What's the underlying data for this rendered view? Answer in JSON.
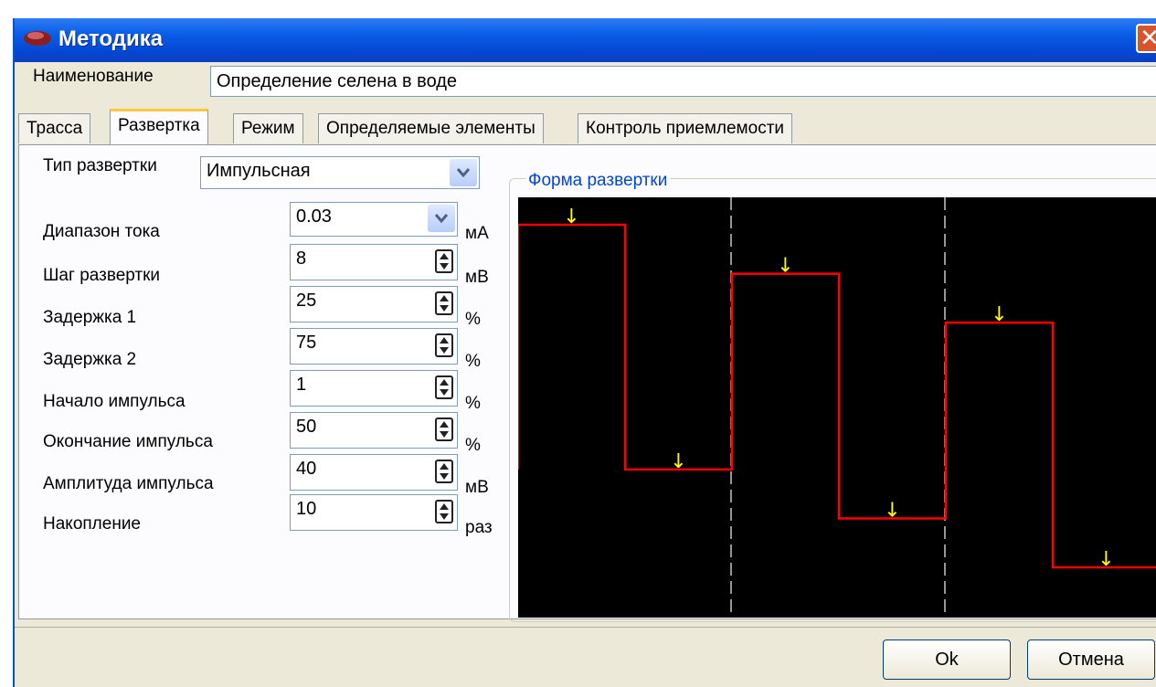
{
  "window": {
    "title": "Методика"
  },
  "name": {
    "label": "Наименование",
    "value": "Определение селена в воде"
  },
  "tabs": [
    "Трасса",
    "Развертка",
    "Режим",
    "Определяемые элементы",
    "Контроль приемлемости"
  ],
  "active_tab": "Развертка",
  "sweep": {
    "type_label": "Тип развертки",
    "type_value": "Импульсная",
    "fields": [
      {
        "label": "Диапазон тока",
        "value": "0.03",
        "unit": "мА",
        "control": "combo"
      },
      {
        "label": "Шаг развертки",
        "value": "8",
        "unit": "мВ",
        "control": "spin"
      },
      {
        "label": "Задержка 1",
        "value": "25",
        "unit": "%",
        "control": "spin"
      },
      {
        "label": "Задержка 2",
        "value": "75",
        "unit": "%",
        "control": "spin"
      },
      {
        "label": "Начало импульса",
        "value": "1",
        "unit": "%",
        "control": "spin"
      },
      {
        "label": "Окончание импульса",
        "value": "50",
        "unit": "%",
        "control": "spin"
      },
      {
        "label": "Амплитуда импульса",
        "value": "40",
        "unit": "мВ",
        "control": "spin"
      },
      {
        "label": "Накопление",
        "value": "10",
        "unit": "раз",
        "control": "spin"
      }
    ]
  },
  "waveform": {
    "title": "Форма развертки",
    "background": "#000000",
    "line_color": "#ff0000",
    "marker_color": "#ffff00",
    "divider_color": "#c8c8c8",
    "periods": 3,
    "pulse_levels": [
      0.0,
      0.2,
      0.4
    ],
    "base_levels": [
      1.0,
      1.2,
      1.4
    ],
    "markers": [
      "↓"
    ]
  },
  "buttons": {
    "ok": "Ok",
    "cancel": "Отмена"
  },
  "colors": {
    "titlebar": "#0a5ee8",
    "dialog": "#ece9d8",
    "close": "#d9532d"
  }
}
